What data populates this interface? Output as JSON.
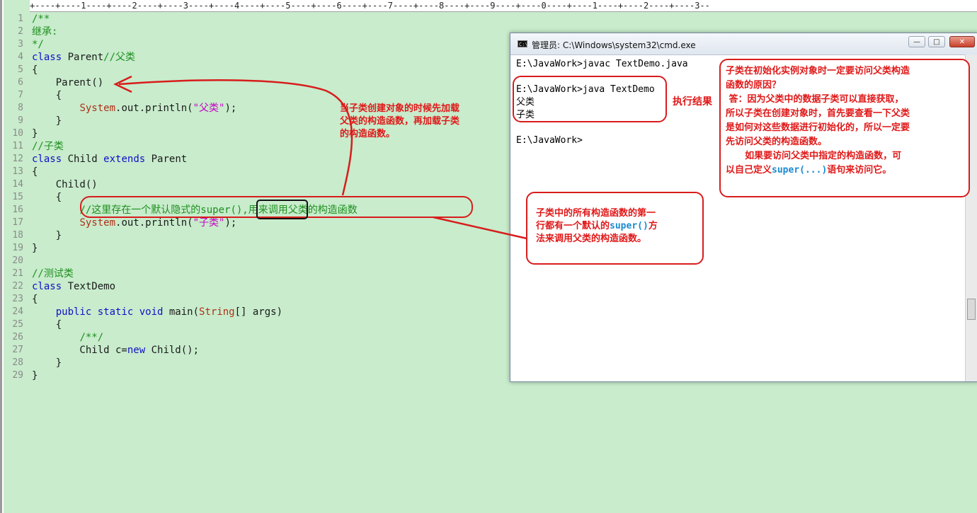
{
  "ruler": {
    "text": "+----+----1----+----2----+----3----+----4----+----5----+----6----+----7----+----8----+----9----+----0----+----1----+----2----+----3--"
  },
  "code": {
    "lines": [
      {
        "n": "1",
        "tokens": [
          {
            "t": "/**",
            "c": "cm"
          }
        ]
      },
      {
        "n": "2",
        "tokens": [
          {
            "t": "继承:",
            "c": "cm"
          }
        ]
      },
      {
        "n": "3",
        "tokens": [
          {
            "t": "*/",
            "c": "cm"
          }
        ]
      },
      {
        "n": "4",
        "tokens": [
          {
            "t": "class",
            "c": "kw"
          },
          {
            "t": " Parent",
            "c": ""
          },
          {
            "t": "//父类",
            "c": "cm"
          }
        ]
      },
      {
        "n": "5",
        "tokens": [
          {
            "t": "{",
            "c": ""
          }
        ]
      },
      {
        "n": "6",
        "tokens": [
          {
            "t": "    Parent()",
            "c": ""
          }
        ]
      },
      {
        "n": "7",
        "tokens": [
          {
            "t": "    {",
            "c": ""
          }
        ]
      },
      {
        "n": "8",
        "tokens": [
          {
            "t": "        ",
            "c": ""
          },
          {
            "t": "System",
            "c": "ty"
          },
          {
            "t": ".out.println(",
            "c": ""
          },
          {
            "t": "\"父类\"",
            "c": "st"
          },
          {
            "t": ");",
            "c": ""
          }
        ]
      },
      {
        "n": "9",
        "tokens": [
          {
            "t": "    }",
            "c": ""
          }
        ]
      },
      {
        "n": "10",
        "tokens": [
          {
            "t": "}",
            "c": ""
          }
        ]
      },
      {
        "n": "11",
        "tokens": [
          {
            "t": "//子类",
            "c": "cm"
          }
        ]
      },
      {
        "n": "12",
        "tokens": [
          {
            "t": "class",
            "c": "kw"
          },
          {
            "t": " Child ",
            "c": ""
          },
          {
            "t": "extends",
            "c": "kw"
          },
          {
            "t": " Parent",
            "c": ""
          }
        ]
      },
      {
        "n": "13",
        "tokens": [
          {
            "t": "{",
            "c": ""
          }
        ]
      },
      {
        "n": "14",
        "tokens": [
          {
            "t": "    Child()",
            "c": ""
          }
        ]
      },
      {
        "n": "15",
        "tokens": [
          {
            "t": "    {",
            "c": ""
          }
        ]
      },
      {
        "n": "16",
        "tokens": [
          {
            "t": "        ",
            "c": ""
          },
          {
            "t": "//这里存在一个默认隐式的super(),用来调用父类的构造函数",
            "c": "cm"
          }
        ]
      },
      {
        "n": "17",
        "tokens": [
          {
            "t": "        ",
            "c": ""
          },
          {
            "t": "System",
            "c": "ty"
          },
          {
            "t": ".out.println(",
            "c": ""
          },
          {
            "t": "\"子类\"",
            "c": "st"
          },
          {
            "t": ");",
            "c": ""
          }
        ]
      },
      {
        "n": "18",
        "tokens": [
          {
            "t": "    }",
            "c": ""
          }
        ]
      },
      {
        "n": "19",
        "tokens": [
          {
            "t": "}",
            "c": ""
          }
        ]
      },
      {
        "n": "20",
        "tokens": []
      },
      {
        "n": "21",
        "tokens": [
          {
            "t": "//测试类",
            "c": "cm"
          }
        ]
      },
      {
        "n": "22",
        "tokens": [
          {
            "t": "class",
            "c": "kw"
          },
          {
            "t": " TextDemo",
            "c": ""
          }
        ]
      },
      {
        "n": "23",
        "tokens": [
          {
            "t": "{",
            "c": ""
          }
        ]
      },
      {
        "n": "24",
        "tokens": [
          {
            "t": "    ",
            "c": ""
          },
          {
            "t": "public static void",
            "c": "kw"
          },
          {
            "t": " main(",
            "c": ""
          },
          {
            "t": "String",
            "c": "ty"
          },
          {
            "t": "[] args)",
            "c": ""
          }
        ]
      },
      {
        "n": "25",
        "tokens": [
          {
            "t": "    {",
            "c": ""
          }
        ]
      },
      {
        "n": "26",
        "tokens": [
          {
            "t": "        ",
            "c": ""
          },
          {
            "t": "/**/",
            "c": "cm"
          }
        ]
      },
      {
        "n": "27",
        "tokens": [
          {
            "t": "        Child c=",
            "c": ""
          },
          {
            "t": "new",
            "c": "kw"
          },
          {
            "t": " Child();",
            "c": ""
          }
        ]
      },
      {
        "n": "28",
        "tokens": [
          {
            "t": "    }",
            "c": ""
          }
        ]
      },
      {
        "n": "29",
        "tokens": [
          {
            "t": "}",
            "c": ""
          }
        ]
      }
    ]
  },
  "cmd": {
    "title": "管理员: C:\\Windows\\system32\\cmd.exe",
    "icon_label": "C:\\",
    "minimize": "—",
    "maximize": "□",
    "close": "✕",
    "lines": [
      "E:\\JavaWork>javac TextDemo.java",
      "",
      "E:\\JavaWork>java TextDemo",
      "父类",
      "子类",
      "",
      "E:\\JavaWork>"
    ]
  },
  "annotations": {
    "order_note": [
      "当子类创建对象的时候先加载",
      "父类的构造函数，再加载子类",
      "的构造函数。"
    ],
    "result_label": "执行结果",
    "super_note": {
      "line1": "子类中的所有构造函数的第一",
      "line2_pre": "行都有一个默认的",
      "line2_code": "super()",
      "line2_post": "方",
      "line3": "法来调用父类的构造函数。"
    },
    "reason_note": {
      "line1": "子类在初始化实例对象时一定要访问父类构造",
      "line2": "函数的原因？",
      "line3": " 答：因为父类中的数据子类可以直接获取，",
      "line4": "所以子类在创建对象时，首先要查看一下父类",
      "line5": "是如何对这些数据进行初始化的，所以一定要",
      "line6": "先访问父类的构造函数。",
      "line7": "      如果要访问父类中指定的构造函数，可",
      "line8_pre": "以自己定义",
      "line8_code": "super(...)",
      "line8_post": "语句来访问它。"
    }
  },
  "colors": {
    "editor_bg": "#c8eccc",
    "keyword": "#1010c8",
    "comment": "#1f8f1f",
    "string": "#c800c8",
    "type": "#b03018",
    "annotation_red": "#e01818"
  }
}
